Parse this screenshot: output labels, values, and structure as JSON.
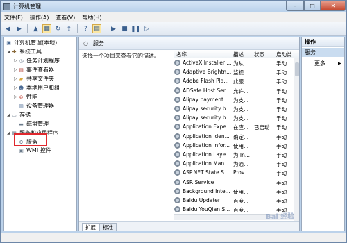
{
  "window": {
    "title": "计算机管理",
    "min_glyph": "–",
    "max_glyph": "□",
    "close_glyph": "✕"
  },
  "menu": [
    "文件(F)",
    "操作(A)",
    "查看(V)",
    "帮助(H)"
  ],
  "tree": {
    "root": "计算机管理(本地)",
    "system_tools": "系统工具",
    "task_scheduler": "任务计划程序",
    "event_viewer": "事件查看器",
    "shared_folders": "共享文件夹",
    "local_users": "本地用户和组",
    "performance": "性能",
    "device_manager": "设备管理器",
    "storage": "存储",
    "disk_management": "磁盘管理",
    "services_apps": "服务和应用程序",
    "services": "服务",
    "wmi": "WMI 控件"
  },
  "center": {
    "title": "服务",
    "description": "选择一个项目来查看它的描述。",
    "columns": {
      "name": "名称",
      "desc": "描述",
      "status": "状态",
      "startup": "启动类"
    },
    "rows": [
      {
        "name": "ActiveX Installer ...",
        "desc": "为从 ...",
        "status": "",
        "startup": "手动"
      },
      {
        "name": "Adaptive Brightn...",
        "desc": "监视...",
        "status": "",
        "startup": "手动"
      },
      {
        "name": "Adobe Flash Pla...",
        "desc": "此服...",
        "status": "",
        "startup": "手动"
      },
      {
        "name": "ADSafe Host Ser...",
        "desc": "允许...",
        "status": "",
        "startup": "手动"
      },
      {
        "name": "Alipay payment ...",
        "desc": "为支...",
        "status": "",
        "startup": "手动"
      },
      {
        "name": "Alipay security b...",
        "desc": "为支...",
        "status": "",
        "startup": "手动"
      },
      {
        "name": "Alipay security b...",
        "desc": "为支...",
        "status": "",
        "startup": "手动"
      },
      {
        "name": "Application Expe...",
        "desc": "在应...",
        "status": "已启动",
        "startup": "手动"
      },
      {
        "name": "Application Iden...",
        "desc": "确定...",
        "status": "",
        "startup": "手动"
      },
      {
        "name": "Application Infor...",
        "desc": "使用...",
        "status": "",
        "startup": "手动"
      },
      {
        "name": "Application Laye...",
        "desc": "为 In...",
        "status": "",
        "startup": "手动"
      },
      {
        "name": "Application Man...",
        "desc": "为通...",
        "status": "",
        "startup": "手动"
      },
      {
        "name": "ASP.NET State S...",
        "desc": "Prov...",
        "status": "",
        "startup": "手动"
      },
      {
        "name": "ASR Service",
        "desc": "",
        "status": "",
        "startup": "手动"
      },
      {
        "name": "Background Inte...",
        "desc": "使用...",
        "status": "",
        "startup": "手动"
      },
      {
        "name": "Baidu Updater",
        "desc": "百度...",
        "status": "",
        "startup": "手动"
      },
      {
        "name": "Baidu YouQian S...",
        "desc": "百度...",
        "status": "",
        "startup": "手动"
      }
    ],
    "tabs": [
      "扩展",
      "标准"
    ]
  },
  "actions": {
    "title": "操作",
    "section": "服务",
    "more": "更多...",
    "more_arrow": "▶"
  },
  "watermark": "Bai 经验"
}
